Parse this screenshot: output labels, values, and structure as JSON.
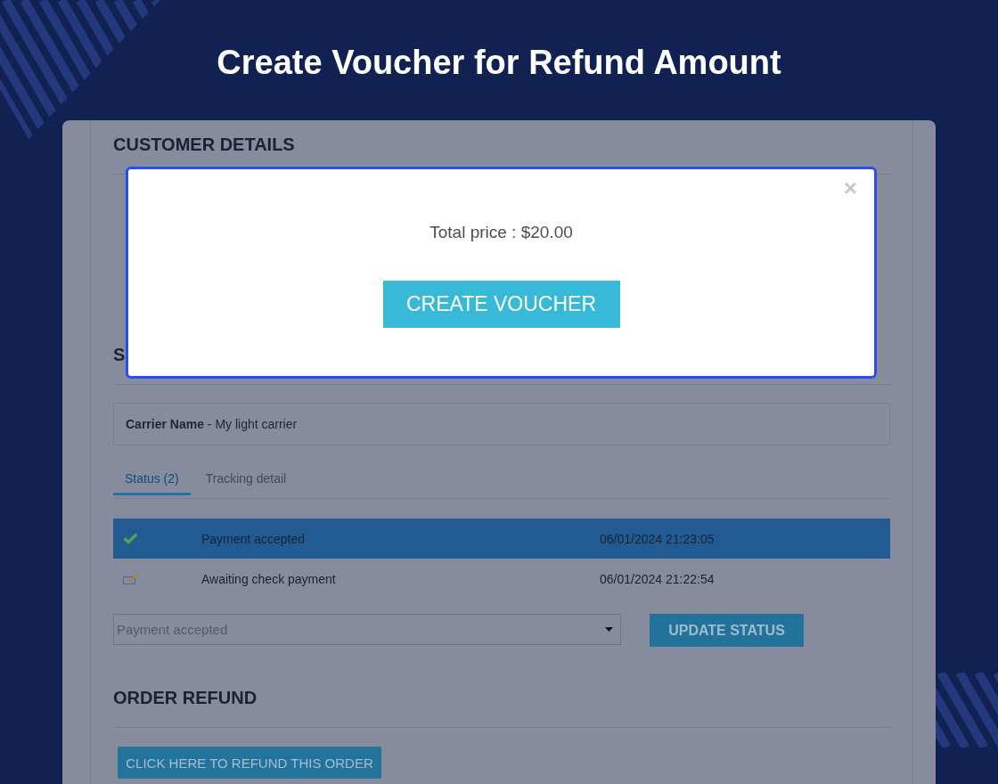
{
  "title": "Create Voucher for Refund Amount",
  "customer_details": {
    "heading": "CUSTOMER DETAILS"
  },
  "shipping": {
    "heading": "S",
    "carrier": "**Carrier Name** - My light carrier",
    "tabs": [
      {
        "label": "Status (2)",
        "selected": true
      },
      {
        "label": "Tracking detail",
        "selected": false
      }
    ],
    "status_rows": [
      {
        "kind": "check",
        "status": "Payment accepted",
        "date": "06/01/2024 21:23:05",
        "selected": true
      },
      {
        "kind": "cheque",
        "status": "Awaiting check payment",
        "date": "06/01/2024 21:22:54",
        "selected": false
      }
    ],
    "status_select": {
      "value": "Payment accepted"
    },
    "update_button": "UPDATE STATUS"
  },
  "order_refund": {
    "heading": "ORDER REFUND",
    "refund_button": "CLICK HERE TO REFUND THIS ORDER"
  },
  "modal": {
    "close": "×",
    "total": "Total price : $20.00",
    "create_button": "CREATE VOUCHER"
  }
}
